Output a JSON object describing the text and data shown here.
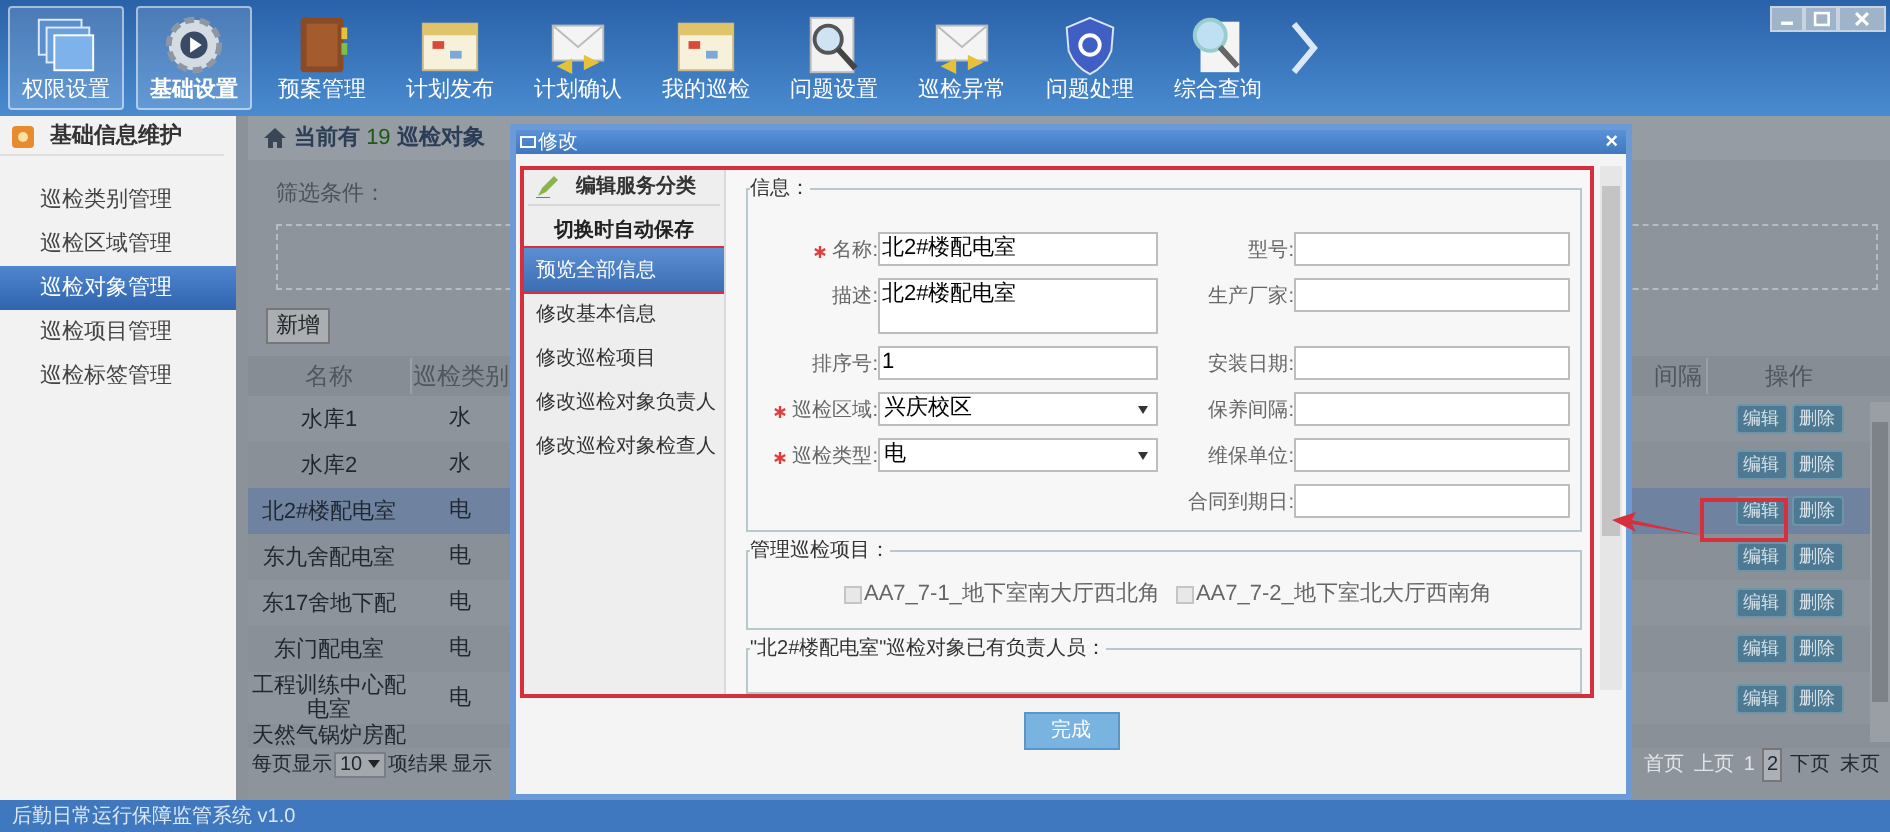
{
  "toolbar": {
    "items": [
      {
        "label": "权限设置",
        "selected": false,
        "highlighted": true
      },
      {
        "label": "基础设置",
        "selected": true,
        "highlighted": true
      },
      {
        "label": "预案管理",
        "selected": false,
        "highlighted": false
      },
      {
        "label": "计划发布",
        "selected": false,
        "highlighted": false
      },
      {
        "label": "计划确认",
        "selected": false,
        "highlighted": false
      },
      {
        "label": "我的巡检",
        "selected": false,
        "highlighted": false
      },
      {
        "label": "问题设置",
        "selected": false,
        "highlighted": false
      },
      {
        "label": "巡检异常",
        "selected": false,
        "highlighted": false
      },
      {
        "label": "问题处理",
        "selected": false,
        "highlighted": false
      },
      {
        "label": "综合查询",
        "selected": false,
        "highlighted": false
      }
    ]
  },
  "sidebar": {
    "title": "基础信息维护",
    "items": [
      {
        "label": "巡检类别管理",
        "selected": false
      },
      {
        "label": "巡检区域管理",
        "selected": false
      },
      {
        "label": "巡检对象管理",
        "selected": true
      },
      {
        "label": "巡检项目管理",
        "selected": false
      },
      {
        "label": "巡检标签管理",
        "selected": false
      }
    ]
  },
  "main": {
    "header": {
      "prefix": "当前有",
      "count": "19",
      "suffix": "巡检对象"
    },
    "filter_label": "筛选条件：",
    "add_button": "新增",
    "table": {
      "columns": [
        "名称",
        "巡检类别",
        "间隔",
        "操作"
      ],
      "rows": [
        {
          "name": "水库1",
          "category": "水",
          "selected": false,
          "actions": [
            "编辑",
            "删除"
          ]
        },
        {
          "name": "水库2",
          "category": "水",
          "selected": false,
          "actions": [
            "编辑",
            "删除"
          ]
        },
        {
          "name": "北2#楼配电室",
          "category": "电",
          "selected": true,
          "actions": [
            "编辑",
            "删除"
          ]
        },
        {
          "name": "东九舍配电室",
          "category": "电",
          "selected": false,
          "actions": [
            "编辑",
            "删除"
          ]
        },
        {
          "name": "东17舍地下配",
          "category": "电",
          "selected": false,
          "actions": [
            "编辑",
            "删除"
          ]
        },
        {
          "name": "东门配电室",
          "category": "电",
          "selected": false,
          "actions": [
            "编辑",
            "删除"
          ]
        },
        {
          "name": "工程训练中心配电室",
          "category": "电",
          "selected": false,
          "actions": [
            "编辑",
            "删除"
          ]
        },
        {
          "name": "天然气锅炉房配",
          "selected": false
        }
      ]
    },
    "pagination": {
      "per_page_label": "每页显示",
      "per_page": "10",
      "results_label": "项结果",
      "showing": "显示",
      "pages": [
        {
          "label": "首页",
          "disabled": true,
          "selected": false
        },
        {
          "label": "上页",
          "disabled": true,
          "selected": false
        },
        {
          "label": "1",
          "disabled": true,
          "selected": false
        },
        {
          "label": "2",
          "disabled": false,
          "selected": true
        },
        {
          "label": "下页",
          "disabled": false,
          "selected": false
        },
        {
          "label": "末页",
          "disabled": false,
          "selected": false
        }
      ]
    }
  },
  "modal": {
    "title": "修改",
    "close": "×",
    "nav": {
      "title": "编辑服务分类",
      "subtitle": "切换时自动保存",
      "items": [
        {
          "label": "预览全部信息",
          "selected": true
        },
        {
          "label": "修改基本信息",
          "selected": false
        },
        {
          "label": "修改巡检项目",
          "selected": false
        },
        {
          "label": "修改巡检对象负责人",
          "selected": false
        },
        {
          "label": "修改巡检对象检查人",
          "selected": false
        }
      ]
    },
    "info": {
      "legend": "信息：",
      "left_fields": [
        {
          "label": "名称:",
          "required": true,
          "kind": "text",
          "value": "北2#楼配电室"
        },
        {
          "label": "描述:",
          "required": false,
          "kind": "textarea",
          "value": "北2#楼配电室"
        },
        {
          "label": "排序号:",
          "required": false,
          "kind": "text",
          "value": "1"
        },
        {
          "label": "巡检区域:",
          "required": true,
          "kind": "select",
          "value": "兴庆校区"
        },
        {
          "label": "巡检类型:",
          "required": true,
          "kind": "select",
          "value": "电"
        }
      ],
      "right_fields": [
        {
          "label": "型号:",
          "required": false,
          "kind": "text"
        },
        {
          "label": "生产厂家:",
          "required": false,
          "kind": "text"
        },
        {
          "label": "安装日期:",
          "required": false,
          "kind": "text"
        },
        {
          "label": "保养间隔:",
          "required": false,
          "kind": "text"
        },
        {
          "label": "维保单位:",
          "required": false,
          "kind": "text"
        },
        {
          "label": "合同到期日:",
          "required": false,
          "kind": "text"
        }
      ]
    },
    "items": {
      "legend": "管理巡检项目：",
      "options": [
        {
          "label": "AA7_7-1_地下室南大厅西北角",
          "checked": false,
          "disabled": true
        },
        {
          "label": "AA7_7-2_地下室北大厅西南角",
          "checked": false,
          "disabled": true
        }
      ]
    },
    "owners": {
      "legend": "\"北2#楼配电室\"巡检对象已有负责人员："
    },
    "done_button": "完成"
  },
  "status_bar": "后勤日常运行保障监管系统 v1.0"
}
